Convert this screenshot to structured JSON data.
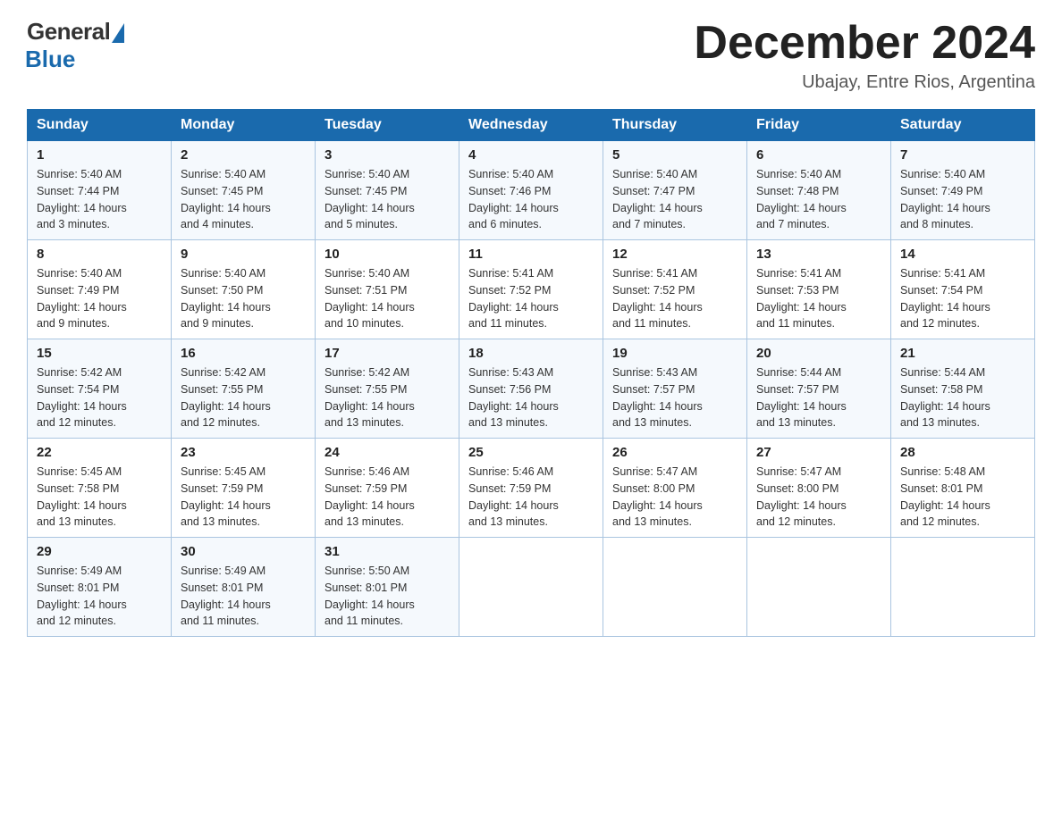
{
  "header": {
    "logo_general": "General",
    "logo_blue": "Blue",
    "month_title": "December 2024",
    "location": "Ubajay, Entre Rios, Argentina"
  },
  "days_of_week": [
    "Sunday",
    "Monday",
    "Tuesday",
    "Wednesday",
    "Thursday",
    "Friday",
    "Saturday"
  ],
  "weeks": [
    [
      {
        "day": "1",
        "sunrise": "5:40 AM",
        "sunset": "7:44 PM",
        "daylight": "14 hours and 3 minutes."
      },
      {
        "day": "2",
        "sunrise": "5:40 AM",
        "sunset": "7:45 PM",
        "daylight": "14 hours and 4 minutes."
      },
      {
        "day": "3",
        "sunrise": "5:40 AM",
        "sunset": "7:45 PM",
        "daylight": "14 hours and 5 minutes."
      },
      {
        "day": "4",
        "sunrise": "5:40 AM",
        "sunset": "7:46 PM",
        "daylight": "14 hours and 6 minutes."
      },
      {
        "day": "5",
        "sunrise": "5:40 AM",
        "sunset": "7:47 PM",
        "daylight": "14 hours and 7 minutes."
      },
      {
        "day": "6",
        "sunrise": "5:40 AM",
        "sunset": "7:48 PM",
        "daylight": "14 hours and 7 minutes."
      },
      {
        "day": "7",
        "sunrise": "5:40 AM",
        "sunset": "7:49 PM",
        "daylight": "14 hours and 8 minutes."
      }
    ],
    [
      {
        "day": "8",
        "sunrise": "5:40 AM",
        "sunset": "7:49 PM",
        "daylight": "14 hours and 9 minutes."
      },
      {
        "day": "9",
        "sunrise": "5:40 AM",
        "sunset": "7:50 PM",
        "daylight": "14 hours and 9 minutes."
      },
      {
        "day": "10",
        "sunrise": "5:40 AM",
        "sunset": "7:51 PM",
        "daylight": "14 hours and 10 minutes."
      },
      {
        "day": "11",
        "sunrise": "5:41 AM",
        "sunset": "7:52 PM",
        "daylight": "14 hours and 11 minutes."
      },
      {
        "day": "12",
        "sunrise": "5:41 AM",
        "sunset": "7:52 PM",
        "daylight": "14 hours and 11 minutes."
      },
      {
        "day": "13",
        "sunrise": "5:41 AM",
        "sunset": "7:53 PM",
        "daylight": "14 hours and 11 minutes."
      },
      {
        "day": "14",
        "sunrise": "5:41 AM",
        "sunset": "7:54 PM",
        "daylight": "14 hours and 12 minutes."
      }
    ],
    [
      {
        "day": "15",
        "sunrise": "5:42 AM",
        "sunset": "7:54 PM",
        "daylight": "14 hours and 12 minutes."
      },
      {
        "day": "16",
        "sunrise": "5:42 AM",
        "sunset": "7:55 PM",
        "daylight": "14 hours and 12 minutes."
      },
      {
        "day": "17",
        "sunrise": "5:42 AM",
        "sunset": "7:55 PM",
        "daylight": "14 hours and 13 minutes."
      },
      {
        "day": "18",
        "sunrise": "5:43 AM",
        "sunset": "7:56 PM",
        "daylight": "14 hours and 13 minutes."
      },
      {
        "day": "19",
        "sunrise": "5:43 AM",
        "sunset": "7:57 PM",
        "daylight": "14 hours and 13 minutes."
      },
      {
        "day": "20",
        "sunrise": "5:44 AM",
        "sunset": "7:57 PM",
        "daylight": "14 hours and 13 minutes."
      },
      {
        "day": "21",
        "sunrise": "5:44 AM",
        "sunset": "7:58 PM",
        "daylight": "14 hours and 13 minutes."
      }
    ],
    [
      {
        "day": "22",
        "sunrise": "5:45 AM",
        "sunset": "7:58 PM",
        "daylight": "14 hours and 13 minutes."
      },
      {
        "day": "23",
        "sunrise": "5:45 AM",
        "sunset": "7:59 PM",
        "daylight": "14 hours and 13 minutes."
      },
      {
        "day": "24",
        "sunrise": "5:46 AM",
        "sunset": "7:59 PM",
        "daylight": "14 hours and 13 minutes."
      },
      {
        "day": "25",
        "sunrise": "5:46 AM",
        "sunset": "7:59 PM",
        "daylight": "14 hours and 13 minutes."
      },
      {
        "day": "26",
        "sunrise": "5:47 AM",
        "sunset": "8:00 PM",
        "daylight": "14 hours and 13 minutes."
      },
      {
        "day": "27",
        "sunrise": "5:47 AM",
        "sunset": "8:00 PM",
        "daylight": "14 hours and 12 minutes."
      },
      {
        "day": "28",
        "sunrise": "5:48 AM",
        "sunset": "8:01 PM",
        "daylight": "14 hours and 12 minutes."
      }
    ],
    [
      {
        "day": "29",
        "sunrise": "5:49 AM",
        "sunset": "8:01 PM",
        "daylight": "14 hours and 12 minutes."
      },
      {
        "day": "30",
        "sunrise": "5:49 AM",
        "sunset": "8:01 PM",
        "daylight": "14 hours and 11 minutes."
      },
      {
        "day": "31",
        "sunrise": "5:50 AM",
        "sunset": "8:01 PM",
        "daylight": "14 hours and 11 minutes."
      },
      null,
      null,
      null,
      null
    ]
  ],
  "labels": {
    "sunrise": "Sunrise:",
    "sunset": "Sunset:",
    "daylight": "Daylight:"
  }
}
